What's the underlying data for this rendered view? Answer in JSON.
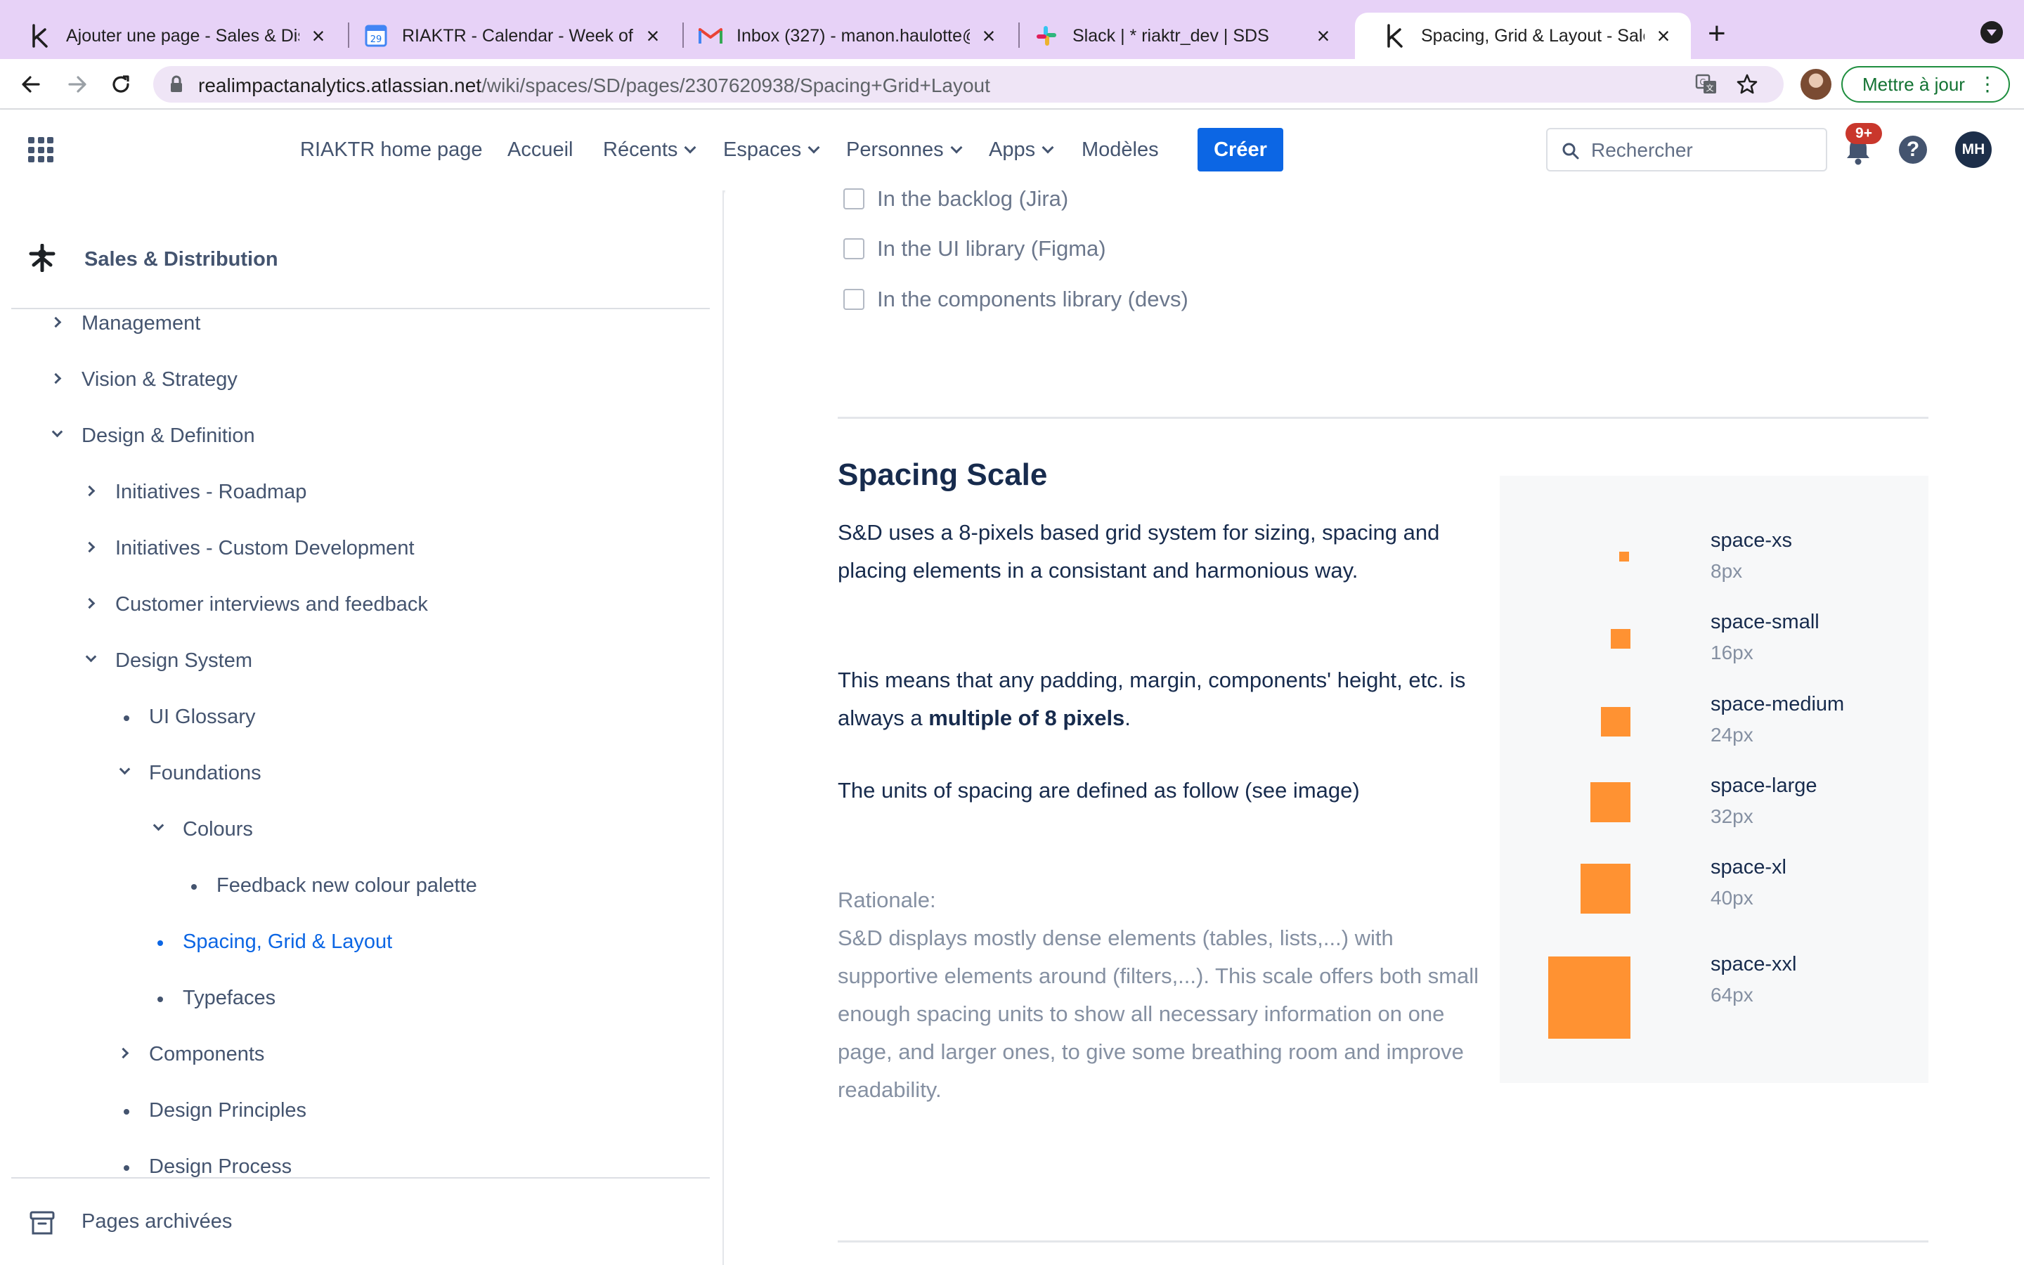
{
  "browser": {
    "tabs": [
      {
        "title": "Ajouter une page - Sales & Dis",
        "icon": "confluence-icon"
      },
      {
        "title": "RIAKTR - Calendar - Week of J",
        "icon": "google-calendar-icon",
        "badge": "29"
      },
      {
        "title": "Inbox (327) - manon.haulotte@",
        "icon": "gmail-icon"
      },
      {
        "title": "Slack | * riaktr_dev | SDS",
        "icon": "slack-icon"
      },
      {
        "title": "Spacing, Grid & Layout - Sales",
        "icon": "confluence-icon",
        "active": true
      }
    ],
    "url_host": "realimpactanalytics.atlassian.net",
    "url_path": "/wiki/spaces/SD/pages/2307620938/Spacing+Grid+Layout",
    "update_label": "Mettre à jour"
  },
  "topnav": {
    "items": [
      {
        "label": "RIAKTR home page",
        "dropdown": false
      },
      {
        "label": "Accueil",
        "dropdown": false
      },
      {
        "label": "Récents",
        "dropdown": true
      },
      {
        "label": "Espaces",
        "dropdown": true
      },
      {
        "label": "Personnes",
        "dropdown": true
      },
      {
        "label": "Apps",
        "dropdown": true
      },
      {
        "label": "Modèles",
        "dropdown": false
      }
    ],
    "create_label": "Créer",
    "search_placeholder": "Rechercher",
    "notifications_badge": "9+",
    "help_label": "?",
    "user_initials": "MH",
    "accent": "#0c66e4"
  },
  "sidebar": {
    "space_name": "Sales & Distribution",
    "tree": [
      {
        "label": "Management",
        "marker": "collapsed"
      },
      {
        "label": "Vision & Strategy",
        "marker": "collapsed"
      },
      {
        "label": "Design & Definition",
        "marker": "expanded"
      },
      {
        "label": "Initiatives - Roadmap",
        "marker": "collapsed"
      },
      {
        "label": "Initiatives - Custom Development",
        "marker": "collapsed"
      },
      {
        "label": "Customer interviews and feedback",
        "marker": "collapsed"
      },
      {
        "label": "Design System",
        "marker": "expanded"
      },
      {
        "label": "UI Glossary",
        "marker": "bullet"
      },
      {
        "label": "Foundations",
        "marker": "expanded"
      },
      {
        "label": "Colours",
        "marker": "expanded"
      },
      {
        "label": "Feedback new colour palette",
        "marker": "bullet"
      },
      {
        "label": "Spacing, Grid & Layout",
        "marker": "bullet",
        "current": true
      },
      {
        "label": "Typefaces",
        "marker": "bullet"
      },
      {
        "label": "Components",
        "marker": "collapsed"
      },
      {
        "label": "Design Principles",
        "marker": "bullet"
      },
      {
        "label": "Design Process",
        "marker": "bullet"
      }
    ],
    "archived_label": "Pages archivées"
  },
  "content": {
    "checklist": [
      {
        "label": "In the backlog (Jira)",
        "checked": false
      },
      {
        "label": "In the UI library (Figma)",
        "checked": false
      },
      {
        "label": "In the components library (devs)",
        "checked": false
      }
    ],
    "section_title": "Spacing Scale",
    "intro": "S&D uses a 8-pixels based grid system for sizing, spacing and placing elements in a consistant and harmonious way.",
    "multiple_prefix": "This means that any padding, margin, components' height, etc. is always a ",
    "multiple_bold": "multiple of 8 pixels",
    "multiple_suffix": ".",
    "units_text": "The units of spacing are defined as follow (see image)",
    "rationale_label": "Rationale:",
    "rationale_text": "S&D displays mostly dense elements (tables, lists,...) with supportive elements around (filters,...). This scale offers both small enough spacing units to show all necessary information on one page, and larger ones, to give some breathing room and improve readability.",
    "scale": [
      {
        "name": "space-xs",
        "value": "8px"
      },
      {
        "name": "space-small",
        "value": "16px"
      },
      {
        "name": "space-medium",
        "value": "24px"
      },
      {
        "name": "space-large",
        "value": "32px"
      },
      {
        "name": "space-xl",
        "value": "40px"
      },
      {
        "name": "space-xxl",
        "value": "64px"
      }
    ],
    "swatch_color": "#ff9232"
  }
}
